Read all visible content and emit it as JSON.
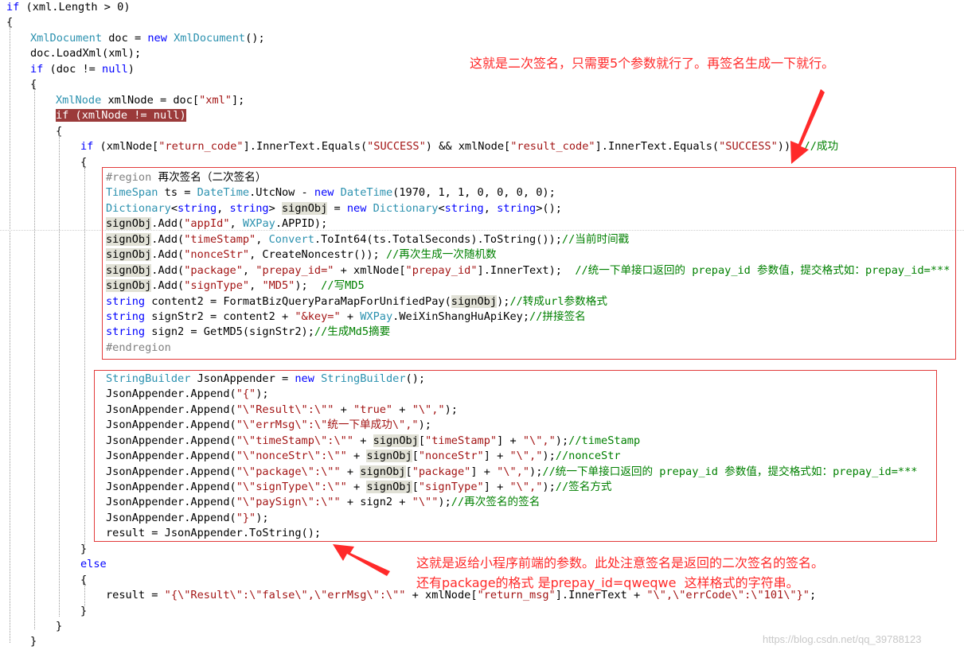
{
  "code": {
    "lines": [
      [
        [
          "if",
          "kw"
        ],
        [
          " (xml.Length > 0)",
          ""
        ]
      ],
      [
        [
          "{",
          ""
        ]
      ],
      [
        [
          "XmlDocument",
          "ty"
        ],
        [
          " doc = ",
          ""
        ],
        [
          "new",
          "kw"
        ],
        [
          " ",
          ""
        ],
        [
          "XmlDocument",
          "ty"
        ],
        [
          "();",
          ""
        ]
      ],
      [
        [
          "doc.LoadXml(xml);",
          ""
        ]
      ],
      [
        [
          "if",
          "kw"
        ],
        [
          " (doc != ",
          ""
        ],
        [
          "null",
          "kw"
        ],
        [
          ")",
          ""
        ]
      ],
      [
        [
          "{",
          ""
        ]
      ],
      [
        [
          "XmlNode",
          "ty"
        ],
        [
          " xmlNode = doc[",
          ""
        ],
        [
          "\"xml\"",
          "st"
        ],
        [
          "];",
          ""
        ]
      ],
      [
        [
          "if (xmlNode != null)",
          "hlred"
        ]
      ],
      [
        [
          "{",
          ""
        ]
      ],
      [
        [
          "if",
          "kw"
        ],
        [
          " (xmlNode[",
          ""
        ],
        [
          "\"return_code\"",
          "st"
        ],
        [
          "].InnerText.Equals(",
          ""
        ],
        [
          "\"SUCCESS\"",
          "st"
        ],
        [
          ") && xmlNode[",
          ""
        ],
        [
          "\"result_code\"",
          "st"
        ],
        [
          "].InnerText.Equals(",
          ""
        ],
        [
          "\"SUCCESS\"",
          "st"
        ],
        [
          "))  ",
          ""
        ],
        [
          "//成功",
          "cm"
        ]
      ],
      [
        [
          "{",
          ""
        ]
      ],
      [
        [
          "#region",
          "rg"
        ],
        [
          " 再次签名（二次签名）",
          ""
        ]
      ],
      [
        [
          "TimeSpan",
          "ty"
        ],
        [
          " ts = ",
          ""
        ],
        [
          "DateTime",
          "ty"
        ],
        [
          ".UtcNow - ",
          ""
        ],
        [
          "new",
          "kw"
        ],
        [
          " ",
          ""
        ],
        [
          "DateTime",
          "ty"
        ],
        [
          "(1970, 1, 1, 0, 0, 0, 0);",
          ""
        ]
      ],
      [
        [
          "Dictionary",
          "ty"
        ],
        [
          "<",
          ""
        ],
        [
          "string",
          "kw"
        ],
        [
          ", ",
          ""
        ],
        [
          "string",
          "kw"
        ],
        [
          "> ",
          ""
        ],
        [
          "signObj",
          "hl"
        ],
        [
          " = ",
          ""
        ],
        [
          "new",
          "kw"
        ],
        [
          " ",
          ""
        ],
        [
          "Dictionary",
          "ty"
        ],
        [
          "<",
          ""
        ],
        [
          "string",
          "kw"
        ],
        [
          ", ",
          ""
        ],
        [
          "string",
          "kw"
        ],
        [
          ">();",
          ""
        ]
      ],
      [
        [
          "signObj",
          "hl"
        ],
        [
          ".Add(",
          ""
        ],
        [
          "\"appId\"",
          "st"
        ],
        [
          ", ",
          ""
        ],
        [
          "WXPay",
          "ty"
        ],
        [
          ".APPID);",
          ""
        ]
      ],
      [
        [
          "signObj",
          "hl"
        ],
        [
          ".Add(",
          ""
        ],
        [
          "\"timeStamp\"",
          "st"
        ],
        [
          ", ",
          ""
        ],
        [
          "Convert",
          "ty"
        ],
        [
          ".ToInt64(ts.TotalSeconds).ToString());",
          ""
        ],
        [
          "//当前时间戳",
          "cm"
        ]
      ],
      [
        [
          "signObj",
          "hl"
        ],
        [
          ".Add(",
          ""
        ],
        [
          "\"nonceStr\"",
          "st"
        ],
        [
          ", CreateNoncestr()); ",
          ""
        ],
        [
          "//再次生成一次随机数",
          "cm"
        ]
      ],
      [
        [
          "signObj",
          "hl"
        ],
        [
          ".Add(",
          ""
        ],
        [
          "\"package\"",
          "st"
        ],
        [
          ", ",
          ""
        ],
        [
          "\"prepay_id=\"",
          "st"
        ],
        [
          " + xmlNode[",
          ""
        ],
        [
          "\"prepay_id\"",
          "st"
        ],
        [
          "].InnerText);  ",
          ""
        ],
        [
          "//统一下单接口返回的 prepay_id 参数值，提交格式如：prepay_id=***",
          "cm"
        ]
      ],
      [
        [
          "signObj",
          "hl"
        ],
        [
          ".Add(",
          ""
        ],
        [
          "\"signType\"",
          "st"
        ],
        [
          ", ",
          ""
        ],
        [
          "\"MD5\"",
          "st"
        ],
        [
          ");  ",
          ""
        ],
        [
          "//写MD5",
          "cm"
        ]
      ],
      [
        [
          "string",
          "kw"
        ],
        [
          " content2 = FormatBizQueryParaMapForUnifiedPay(",
          ""
        ],
        [
          "signObj",
          "hl"
        ],
        [
          ");",
          ""
        ],
        [
          "//转成url参数格式",
          "cm"
        ]
      ],
      [
        [
          "string",
          "kw"
        ],
        [
          " signStr2 = content2 + ",
          ""
        ],
        [
          "\"&key=\"",
          "st"
        ],
        [
          " + ",
          ""
        ],
        [
          "WXPay",
          "ty"
        ],
        [
          ".WeiXinShangHuApiKey;",
          ""
        ],
        [
          "//拼接签名",
          "cm"
        ]
      ],
      [
        [
          "string",
          "kw"
        ],
        [
          " sign2 = GetMD5(signStr2);",
          ""
        ],
        [
          "//生成Md5摘要",
          "cm"
        ]
      ],
      [
        [
          "#endregion",
          "rg"
        ]
      ],
      [
        [
          "",
          ""
        ]
      ],
      [
        [
          "StringBuilder",
          "ty"
        ],
        [
          " JsonAppender = ",
          ""
        ],
        [
          "new",
          "kw"
        ],
        [
          " ",
          ""
        ],
        [
          "StringBuilder",
          "ty"
        ],
        [
          "();",
          ""
        ]
      ],
      [
        [
          "JsonAppender.Append(",
          ""
        ],
        [
          "\"{\"",
          "st"
        ],
        [
          ");",
          ""
        ]
      ],
      [
        [
          "JsonAppender.Append(",
          ""
        ],
        [
          "\"\\\"Result\\\":\\\"\"",
          "st"
        ],
        [
          " + ",
          ""
        ],
        [
          "\"true\"",
          "st"
        ],
        [
          " + ",
          ""
        ],
        [
          "\"\\\",\"",
          "st"
        ],
        [
          ");",
          ""
        ]
      ],
      [
        [
          "JsonAppender.Append(",
          ""
        ],
        [
          "\"\\\"errMsg\\\":\\\"统一下单成功\\\",\"",
          "st"
        ],
        [
          ");",
          ""
        ]
      ],
      [
        [
          "JsonAppender.Append(",
          ""
        ],
        [
          "\"\\\"timeStamp\\\":\\\"\"",
          "st"
        ],
        [
          " + ",
          ""
        ],
        [
          "signObj",
          "hl"
        ],
        [
          "[",
          ""
        ],
        [
          "\"timeStamp\"",
          "st"
        ],
        [
          "] + ",
          ""
        ],
        [
          "\"\\\",\"",
          "st"
        ],
        [
          ");",
          ""
        ],
        [
          "//timeStamp",
          "cm"
        ]
      ],
      [
        [
          "JsonAppender.Append(",
          ""
        ],
        [
          "\"\\\"nonceStr\\\":\\\"\"",
          "st"
        ],
        [
          " + ",
          ""
        ],
        [
          "signObj",
          "hl"
        ],
        [
          "[",
          ""
        ],
        [
          "\"nonceStr\"",
          "st"
        ],
        [
          "] + ",
          ""
        ],
        [
          "\"\\\",\"",
          "st"
        ],
        [
          ");",
          ""
        ],
        [
          "//nonceStr",
          "cm"
        ]
      ],
      [
        [
          "JsonAppender.Append(",
          ""
        ],
        [
          "\"\\\"package\\\":\\\"\"",
          "st"
        ],
        [
          " + ",
          ""
        ],
        [
          "signObj",
          "hl"
        ],
        [
          "[",
          ""
        ],
        [
          "\"package\"",
          "st"
        ],
        [
          "] + ",
          ""
        ],
        [
          "\"\\\",\"",
          "st"
        ],
        [
          ");",
          ""
        ],
        [
          "//统一下单接口返回的 prepay_id 参数值，提交格式如：prepay_id=***",
          "cm"
        ]
      ],
      [
        [
          "JsonAppender.Append(",
          ""
        ],
        [
          "\"\\\"signType\\\":\\\"\"",
          "st"
        ],
        [
          " + ",
          ""
        ],
        [
          "signObj",
          "hl"
        ],
        [
          "[",
          ""
        ],
        [
          "\"signType\"",
          "st"
        ],
        [
          "] + ",
          ""
        ],
        [
          "\"\\\",\"",
          "st"
        ],
        [
          ");",
          ""
        ],
        [
          "//签名方式",
          "cm"
        ]
      ],
      [
        [
          "JsonAppender.Append(",
          ""
        ],
        [
          "\"\\\"paySign\\\":\\\"\"",
          "st"
        ],
        [
          " + sign2 + ",
          ""
        ],
        [
          "\"\\\"\"",
          "st"
        ],
        [
          ");",
          ""
        ],
        [
          "//再次签名的签名",
          "cm"
        ]
      ],
      [
        [
          "JsonAppender.Append(",
          ""
        ],
        [
          "\"}\"",
          "st"
        ],
        [
          ");",
          ""
        ]
      ],
      [
        [
          "result = JsonAppender.ToString();",
          ""
        ]
      ],
      [
        [
          "}",
          ""
        ]
      ],
      [
        [
          "else",
          "kw"
        ]
      ],
      [
        [
          "{",
          ""
        ]
      ],
      [
        [
          "result = ",
          ""
        ],
        [
          "\"{\\\"Result\\\":\\\"false\\\",\\\"errMsg\\\":\\\"\"",
          "st"
        ],
        [
          " + xmlNode[",
          ""
        ],
        [
          "\"return_msg\"",
          "st"
        ],
        [
          "].InnerText + ",
          ""
        ],
        [
          "\"\\\",\\\"errCode\\\":\\\"101\\\"}\"",
          "st"
        ],
        [
          ";",
          ""
        ]
      ],
      [
        [
          "}",
          ""
        ]
      ],
      [
        [
          "}",
          ""
        ]
      ],
      [
        [
          "}",
          ""
        ]
      ]
    ]
  },
  "annotations": {
    "top_note": "这就是二次签名，只需要5个参数就行了。再签名生成一下就行。",
    "bottom_note_line1": "这就是返给小程序前端的参数。此处注意签名是返回的二次签名的签名。",
    "bottom_note_line2": "还有package的格式 是prepay_id=qweqwe  这样格式的字符串。"
  },
  "watermark": "https://blog.csdn.net/qq_39788123"
}
